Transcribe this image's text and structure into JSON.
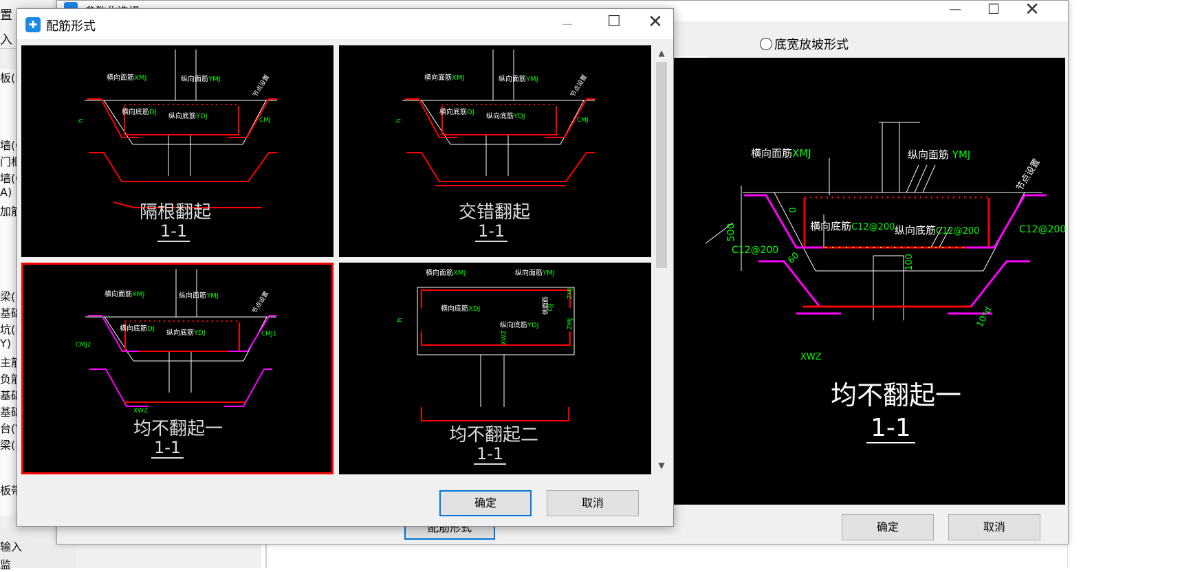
{
  "background_panel": {
    "menu_fragments": [
      "置",
      "入"
    ],
    "side_items": [
      "板(I",
      "墙(Q",
      "门框",
      "墙(Q",
      "A)",
      "加筋",
      "梁(I",
      "基础",
      "坑(I",
      "Y)",
      "主筋",
      "负筋",
      "基础",
      "基础",
      "台(V",
      "梁(I",
      "板带"
    ],
    "bottom_items": [
      "输入",
      "监"
    ]
  },
  "param_window": {
    "title": "参数化选择",
    "radio_label": "底宽放坡形式",
    "behind_button": "配筋形式",
    "ok_label": "确定",
    "cancel_label": "取消",
    "big_one": "1",
    "preview": {
      "xmj": "横向面筋",
      "xmj_code": "XMJ",
      "ymj": "纵向面筋",
      "ymj_code": "YMJ",
      "xdj": "横向底筋",
      "xdj_spec": "C12@200",
      "ydj": "纵向底筋",
      "ydj_spec": "C12@200",
      "slope_spec": "C12@200",
      "left_spec": "C12@200",
      "height": "500",
      "zero": "0",
      "hundred": "100",
      "angle": "60",
      "ten_d": "10*d",
      "xwz": "XWZ",
      "node": "节点设置",
      "name": "均不翻起一",
      "section": "1-1"
    }
  },
  "dialog": {
    "title": "配筋形式",
    "ok_label": "确定",
    "cancel_label": "取消",
    "options": [
      {
        "name": "隔根翻起",
        "section": "1-1",
        "selected": false
      },
      {
        "name": "交错翻起",
        "section": "1-1",
        "selected": false
      },
      {
        "name": "均不翻起一",
        "section": "1-1",
        "selected": true
      },
      {
        "name": "均不翻起二",
        "section": "1-1",
        "selected": false
      }
    ],
    "thumb_labels": {
      "xmj": "横向面筋",
      "xmj_code": "XMJ",
      "ymj": "纵向面筋",
      "ymj_code": "YMJ",
      "xdj": "横向底筋",
      "xdj_code": "DJ",
      "xdj_code2": "XDJ",
      "ydj": "纵向底筋",
      "ydj_code": "YDJ",
      "cmj": "CMJ",
      "cmj1": "CMJ1",
      "cmj2": "CMJ2",
      "xwz": "XWZ",
      "node": "节点设置",
      "h": "h",
      "angle": "60",
      "side_bar": "侧面筋",
      "cjj": "CJJ",
      "zmj": "ZMJ",
      "zmj2": "ZMJ",
      "xwz_code": "XWZ"
    }
  },
  "colors": {
    "accent": "#0078d7",
    "selected": "#ff0000",
    "rebar_red": "#ff0000",
    "rebar_magenta": "#ff00ff",
    "label_green": "#00ff00"
  }
}
